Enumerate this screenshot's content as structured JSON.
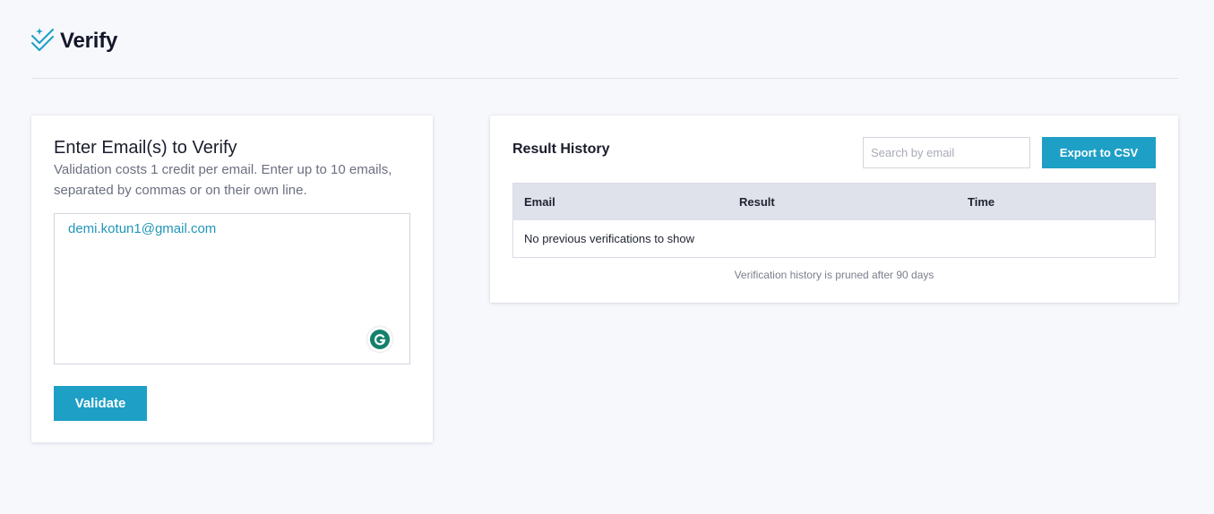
{
  "brand": {
    "name": "Verify",
    "icon": "verify-check-sparkle-icon",
    "accent": "#1e9fc6"
  },
  "input_card": {
    "title": "Enter Email(s) to Verify",
    "description": "Validation costs 1 credit per email. Enter up to 10 emails, separated by commas or on their own line.",
    "emails_value": "demi.kotun1@gmail.com",
    "grammarly_icon": "grammarly-icon",
    "validate_label": "Validate"
  },
  "history_card": {
    "title": "Result History",
    "search_placeholder": "Search by email",
    "export_label": "Export to CSV",
    "columns": [
      "Email",
      "Result",
      "Time"
    ],
    "empty_message": "No previous verifications to show",
    "footnote": "Verification history is pruned after 90 days"
  }
}
